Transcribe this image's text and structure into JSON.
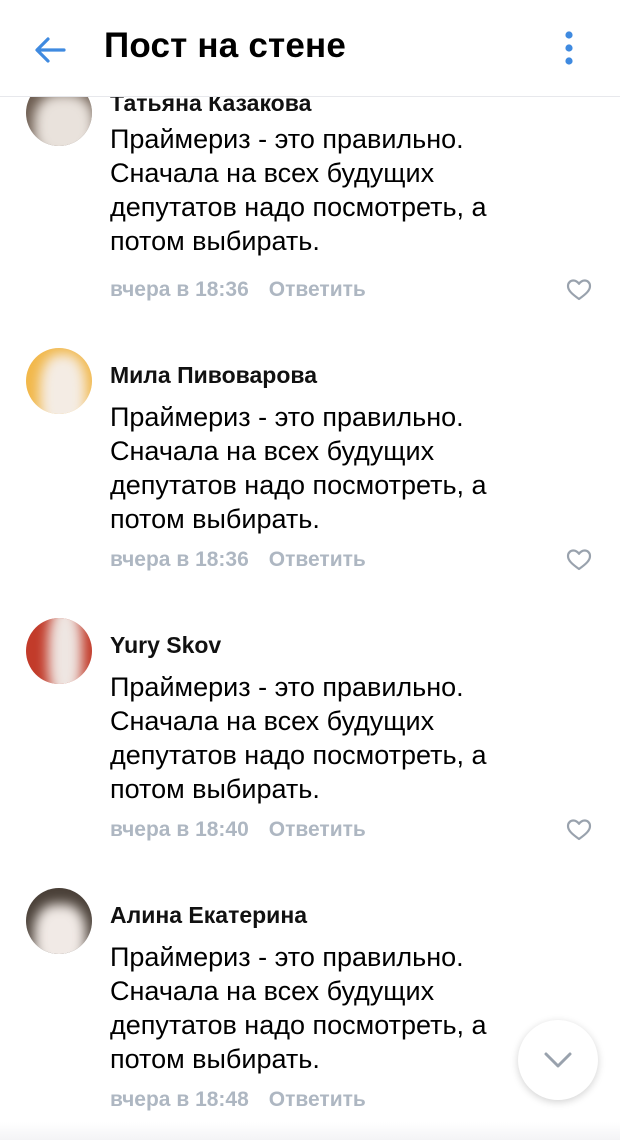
{
  "header": {
    "title": "Пост на стене",
    "back_icon": "arrow-left-icon",
    "menu_icon": "more-vertical-icon",
    "accent": "#3f8ae0"
  },
  "comments": [
    {
      "author": "Татьяна Казакова",
      "lines": [
        "Праймериз - это правильно.",
        "Сначала на всех будущих",
        "депутатов надо посмотреть, а",
        "потом выбирать."
      ],
      "time": "вчера в 18:36",
      "reply": "Ответить"
    },
    {
      "author": "Мила Пивоварова",
      "lines": [
        "Праймериз - это правильно.",
        "Сначала на всех будущих",
        "депутатов надо посмотреть, а",
        "потом выбирать."
      ],
      "time": "вчера в 18:36",
      "reply": "Ответить"
    },
    {
      "author": "Yury Skov",
      "lines": [
        "Праймериз - это правильно.",
        "Сначала на всех будущих",
        "депутатов надо посмотреть, а",
        "потом выбирать."
      ],
      "time": "вчера в 18:40",
      "reply": "Ответить"
    },
    {
      "author": "Алина Екатерина",
      "lines": [
        "Праймериз - это правильно.",
        "Сначала на всех будущих",
        "депутатов надо посмотреть, а",
        "потом выбирать."
      ],
      "time": "вчера в 18:48",
      "reply": "Ответить"
    }
  ],
  "like_icon": "heart-outline-icon",
  "scroll_down_icon": "chevron-down-icon",
  "colors": {
    "meta": "#aeb7c2",
    "heart": "#99a2ad"
  }
}
